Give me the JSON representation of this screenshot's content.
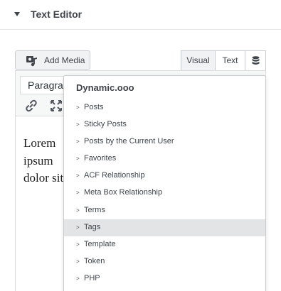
{
  "section": {
    "title": "Text Editor",
    "caret_icon": "caret-down-icon"
  },
  "toolbar": {
    "add_media_label": "Add Media",
    "add_media_icon": "media-icon",
    "tabs": {
      "visual": "Visual",
      "text": "Text",
      "db_icon": "database-icon"
    },
    "format_value": "Paragraph",
    "link_icon": "link-icon",
    "fullscreen_icon": "fullscreen-icon"
  },
  "editor": {
    "content": "Lorem ipsum dolor sit amet, consectetur adipiscing elit, sed do eiusmod tempor incididunt ut labore et dolore magna aliqua. Ut enim ad minim veniam, quis nostrud exercitation ullamco laboris nisi ut aliquip ex ea commodo consequat."
  },
  "dropdown": {
    "title": "Dynamic.ooo",
    "items": [
      {
        "label": "Posts"
      },
      {
        "label": "Sticky Posts"
      },
      {
        "label": "Posts by the Current User"
      },
      {
        "label": "Favorites"
      },
      {
        "label": "ACF Relationship"
      },
      {
        "label": "Meta Box Relationship"
      },
      {
        "label": "Terms"
      },
      {
        "label": "Tags",
        "highlighted": true
      },
      {
        "label": "Template"
      },
      {
        "label": "Token"
      },
      {
        "label": "PHP"
      }
    ]
  },
  "colors": {
    "highlight": "#e3e4e6",
    "text": "#3f444b",
    "border": "#c8ccd0"
  }
}
